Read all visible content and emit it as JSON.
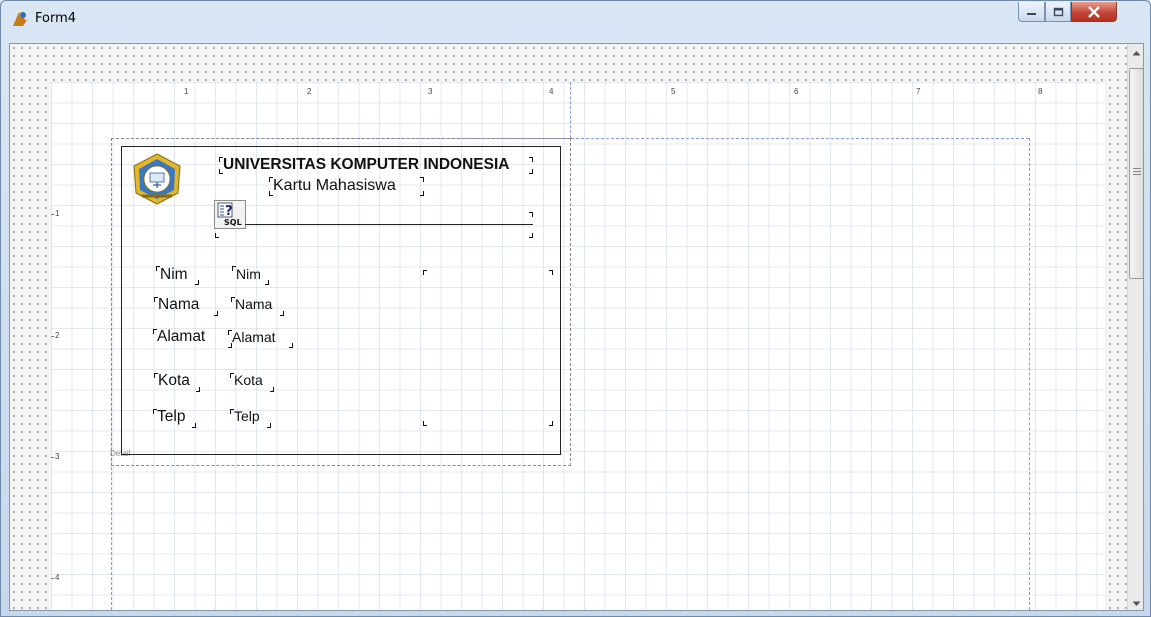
{
  "window": {
    "title": "Form4"
  },
  "ruler": {
    "horizontal": [
      "1",
      "2",
      "3",
      "4",
      "5",
      "6",
      "7",
      "8"
    ],
    "vertical": [
      "1",
      "2",
      "3",
      "4"
    ]
  },
  "band": {
    "label": "Detail"
  },
  "report": {
    "title": "UNIVERSITAS KOMPUTER INDONESIA",
    "subtitle": "Kartu Mahasiswa",
    "sql_icon_label": "SQL",
    "captions": [
      "Nim",
      "Nama",
      "Alamat",
      "Kota",
      "Telp"
    ],
    "fields": [
      "Nim",
      "Nama",
      "Alamat",
      "Kota",
      "Telp"
    ]
  },
  "colors": {
    "guide": "#8a97dc",
    "close_button": "#c4453a",
    "logo_gold": "#e3b72b"
  }
}
